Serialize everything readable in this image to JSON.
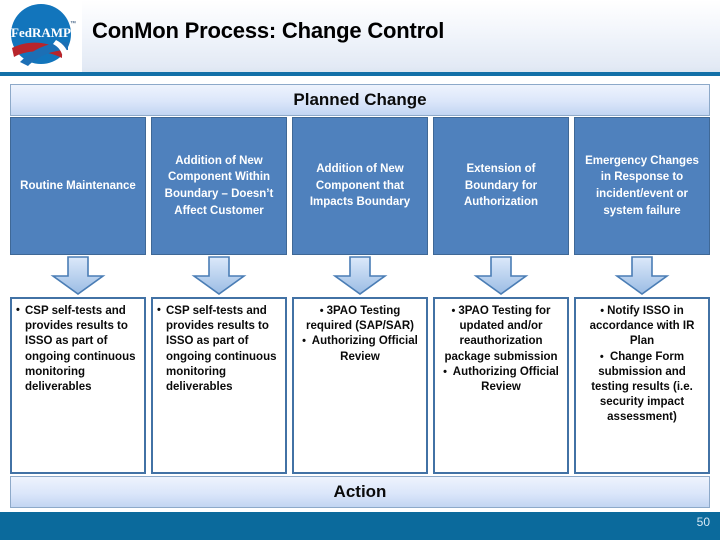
{
  "header": {
    "title": "ConMon Process: Change Control",
    "logo_alt": "FedRAMP",
    "logo_text": "FedRAMP",
    "logo_tm": "™",
    "logo_circle_color": "#1275BC",
    "logo_red_color": "#B8252B",
    "logo_blue_swoosh_color": "#1C6FB5"
  },
  "diagram": {
    "top_band_label": "Planned Change",
    "bottom_band_label": "Action",
    "cause_box_color": "#4F81BD",
    "cause_box_border": "#3F6896",
    "action_box_border": "#4272A5",
    "arrow_fill_top": "#DCE9FA",
    "arrow_fill_bottom": "#9BBCE4",
    "arrow_stroke": "#4A7DB5",
    "columns": [
      {
        "cause": "Routine Maintenance",
        "actions": [
          "CSP self-tests and provides results to ISSO as part of ongoing continuous monitoring deliverables"
        ],
        "align": "left"
      },
      {
        "cause": "Addition of New Component Within Boundary – Doesn’t Affect Customer",
        "actions": [
          "CSP self-tests and provides results to ISSO as part of ongoing continuous monitoring deliverables"
        ],
        "align": "left"
      },
      {
        "cause": "Addition of  New Component that Impacts Boundary",
        "actions": [
          "3PAO Testing required (SAP/SAR)",
          " Authorizing Official Review"
        ],
        "align": "center"
      },
      {
        "cause": "Extension of Boundary for Authorization",
        "actions": [
          "3PAO Testing for updated and/or reauthorization package submission",
          " Authorizing Official Review"
        ],
        "align": "center"
      },
      {
        "cause": "Emergency Changes in Response  to incident/event or system failure",
        "actions": [
          "Notify ISSO in accordance with IR Plan",
          " Change Form submission and testing results (i.e. security impact assessment)"
        ],
        "align": "center"
      }
    ]
  },
  "footer": {
    "page_number": "50",
    "bar_color": "#0B6A9C"
  }
}
